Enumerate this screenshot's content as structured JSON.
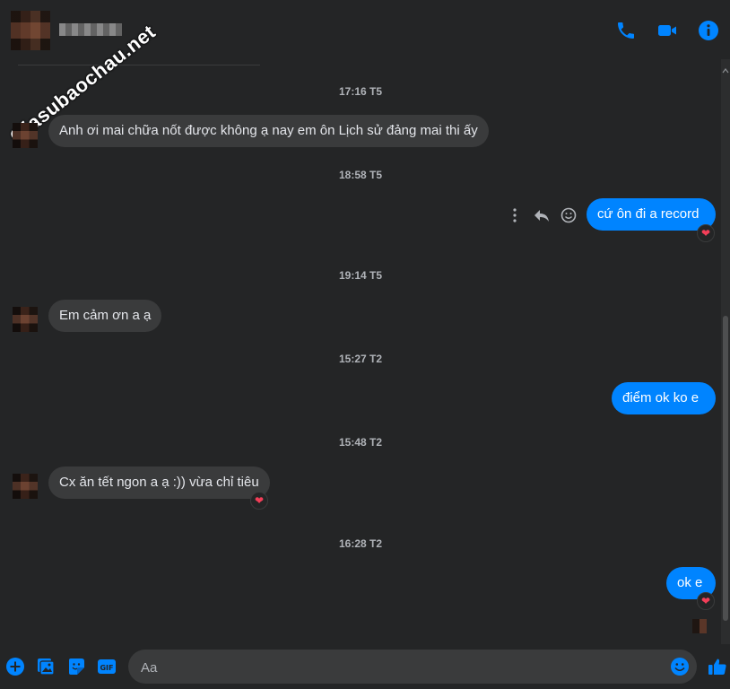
{
  "watermark": "Giasubaochau.net",
  "header": {
    "icons": [
      "phone-icon",
      "video-camera-icon",
      "info-icon"
    ],
    "accent": "#0084ff"
  },
  "messages": [
    {
      "type": "timestamp",
      "text": "17:16 T5"
    },
    {
      "type": "incoming",
      "text": "Anh ơi mai chữa nốt được không ạ nay em ôn Lịch sử đảng mai thi ấy"
    },
    {
      "type": "timestamp",
      "text": "18:58 T5"
    },
    {
      "type": "outgoing",
      "text": "cứ ôn đi a record",
      "reaction": "❤"
    },
    {
      "type": "timestamp",
      "text": "19:14 T5"
    },
    {
      "type": "incoming",
      "text": "Em cảm ơn a ạ"
    },
    {
      "type": "timestamp",
      "text": "15:27 T2"
    },
    {
      "type": "outgoing",
      "text": "điểm ok ko e"
    },
    {
      "type": "timestamp",
      "text": "15:48 T2"
    },
    {
      "type": "incoming",
      "text": "Cx ăn tết ngon a ạ :)) vừa chỉ tiêu",
      "reaction": "❤"
    },
    {
      "type": "timestamp",
      "text": "16:28 T2"
    },
    {
      "type": "outgoing",
      "text": "ok e",
      "reaction": "❤"
    }
  ],
  "message_actions": [
    "more-options-icon",
    "reply-icon",
    "react-icon"
  ],
  "composer": {
    "placeholder": "Aa",
    "icons": [
      "plus-icon",
      "image-icon",
      "sticker-icon",
      "gif-icon",
      "emoji-icon",
      "like-icon"
    ]
  },
  "colors": {
    "background": "#242526",
    "incoming_bubble": "#3a3b3c",
    "outgoing_bubble": "#0084ff",
    "timestamp": "#b0b3b8",
    "reaction": "#f33e58"
  }
}
